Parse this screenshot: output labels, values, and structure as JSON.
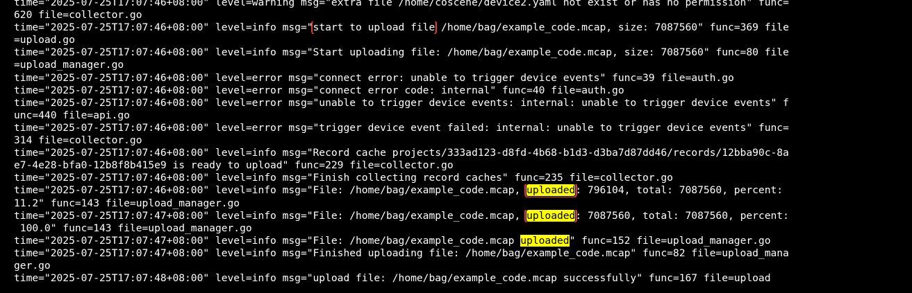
{
  "terminal": {
    "colors": {
      "background": "#000000",
      "text": "#ffffff",
      "highlight": "#ffff00",
      "annotation_box": "#e03b3b"
    },
    "lines": [
      [
        {
          "t": "time=\"2025-07-25T17:07:46+08:00\" level=warning msg=\"extra file /home/coscene/device2.yaml not exist or has no permission\" func="
        }
      ],
      [
        {
          "t": "620 file=collector.go"
        }
      ],
      [
        {
          "t": "time=\"2025-07-25T17:07:46+08:00\" level=info msg=\""
        },
        {
          "t": "start to upload file",
          "box": true
        },
        {
          "t": " /home/bag/example_code.mcap, size: 7087560\" func=369 file"
        }
      ],
      [
        {
          "t": "=upload.go"
        }
      ],
      [
        {
          "t": "time=\"2025-07-25T17:07:46+08:00\" level=info msg=\"Start uploading file: /home/bag/example_code.mcap, size: 7087560\" func=80 file"
        }
      ],
      [
        {
          "t": "=upload_manager.go"
        }
      ],
      [
        {
          "t": "time=\"2025-07-25T17:07:46+08:00\" level=error msg=\"connect error: unable to trigger device events\" func=39 file=auth.go"
        }
      ],
      [
        {
          "t": "time=\"2025-07-25T17:07:46+08:00\" level=error msg=\"connect error code: internal\" func=40 file=auth.go"
        }
      ],
      [
        {
          "t": "time=\"2025-07-25T17:07:46+08:00\" level=error msg=\"unable to trigger device events: internal: unable to trigger device events\" f"
        }
      ],
      [
        {
          "t": "unc=440 file=api.go"
        }
      ],
      [
        {
          "t": "time=\"2025-07-25T17:07:46+08:00\" level=error msg=\"trigger device event failed: internal: unable to trigger device events\" func="
        }
      ],
      [
        {
          "t": "314 file=collector.go"
        }
      ],
      [
        {
          "t": "time=\"2025-07-25T17:07:46+08:00\" level=info msg=\"Record cache projects/333ad123-d8fd-4b68-b1d3-d3ba7d87dd46/records/12bba90c-8a"
        }
      ],
      [
        {
          "t": "e7-4e28-bfa0-12b8f8b415e9 is ready to upload\" func=229 file=collector.go"
        }
      ],
      [
        {
          "t": "time=\"2025-07-25T17:07:46+08:00\" level=info msg=\"Finish collecting record caches\" func=235 file=collector.go"
        }
      ],
      [
        {
          "t": "time=\"2025-07-25T17:07:46+08:00\" level=info msg=\"File: /home/bag/example_code.mcap, "
        },
        {
          "t": "uploaded",
          "hl": true,
          "box": true
        },
        {
          "t": ": 796104, total: 7087560, percent: "
        }
      ],
      [
        {
          "t": "11.2\" func=143 file=upload_manager.go"
        }
      ],
      [
        {
          "t": "time=\"2025-07-25T17:07:47+08:00\" level=info msg=\"File: /home/bag/example_code.mcap, "
        },
        {
          "t": "uploaded",
          "hl": true,
          "box": true
        },
        {
          "t": ": 7087560, total: 7087560, percent:"
        }
      ],
      [
        {
          "t": " 100.0\" func=143 file=upload_manager.go"
        }
      ],
      [
        {
          "t": "time=\"2025-07-25T17:07:47+08:00\" level=info msg=\"File: /home/bag/example_code.mcap "
        },
        {
          "t": "uploaded",
          "hl": true
        },
        {
          "t": "\" func=152 file=upload_manager.go"
        }
      ],
      [
        {
          "t": "time=\"2025-07-25T17:07:47+08:00\" level=info msg=\"Finished uploading file: /home/bag/example_code.mcap\" func=82 file=upload_mana"
        }
      ],
      [
        {
          "t": "ger.go"
        }
      ],
      [
        {
          "t": "time=\"2025-07-25T17:07:48+08:00\" level=info msg=\"upload file: /home/bag/example_code.mcap successfully\" func=167 file=upload"
        }
      ]
    ]
  }
}
